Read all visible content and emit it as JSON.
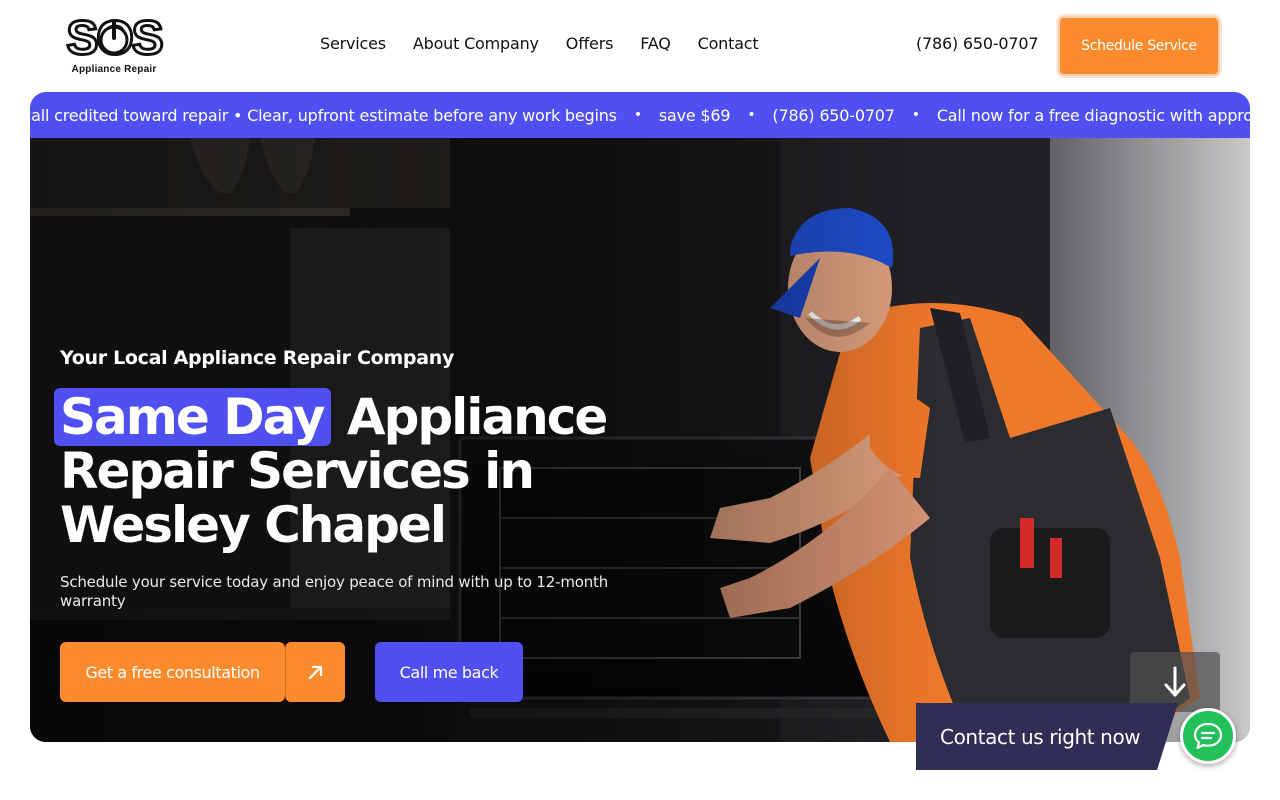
{
  "brand": {
    "logo_text": "Appliance Repair",
    "logo_letters": "SOS",
    "accent_orange": "#fb8b2c",
    "accent_blue": "#4f4ff2",
    "chat_green": "#22c05a"
  },
  "nav": {
    "items": [
      "Services",
      "About Company",
      "Offers",
      "FAQ",
      "Contact"
    ]
  },
  "header": {
    "phone": "(786) 650-0707",
    "schedule_label": "Schedule Service"
  },
  "ticker": {
    "items": [
      "e call credited toward repair • Clear, upfront estimate before any work begins",
      "save $69",
      "(786) 650-0707",
      "Call now for a free diagnostic with approved"
    ]
  },
  "hero": {
    "eyebrow": "Your Local Appliance Repair Company",
    "headline_highlight": "Same Day",
    "headline_rest_1": "Appliance",
    "headline_line_2": "Repair Services in",
    "headline_line_3": "Wesley Chapel",
    "subtext": "Schedule your service today and enjoy peace of mind with up to 12-month warranty",
    "cta_primary": "Get a free consultation",
    "cta_secondary": "Call me back",
    "arrow_icon": "arrow-up-right-icon",
    "scroll_icon": "arrow-down-icon"
  },
  "contact_widget": {
    "label": "Contact us right now",
    "icon": "chat-bubble-icon"
  }
}
